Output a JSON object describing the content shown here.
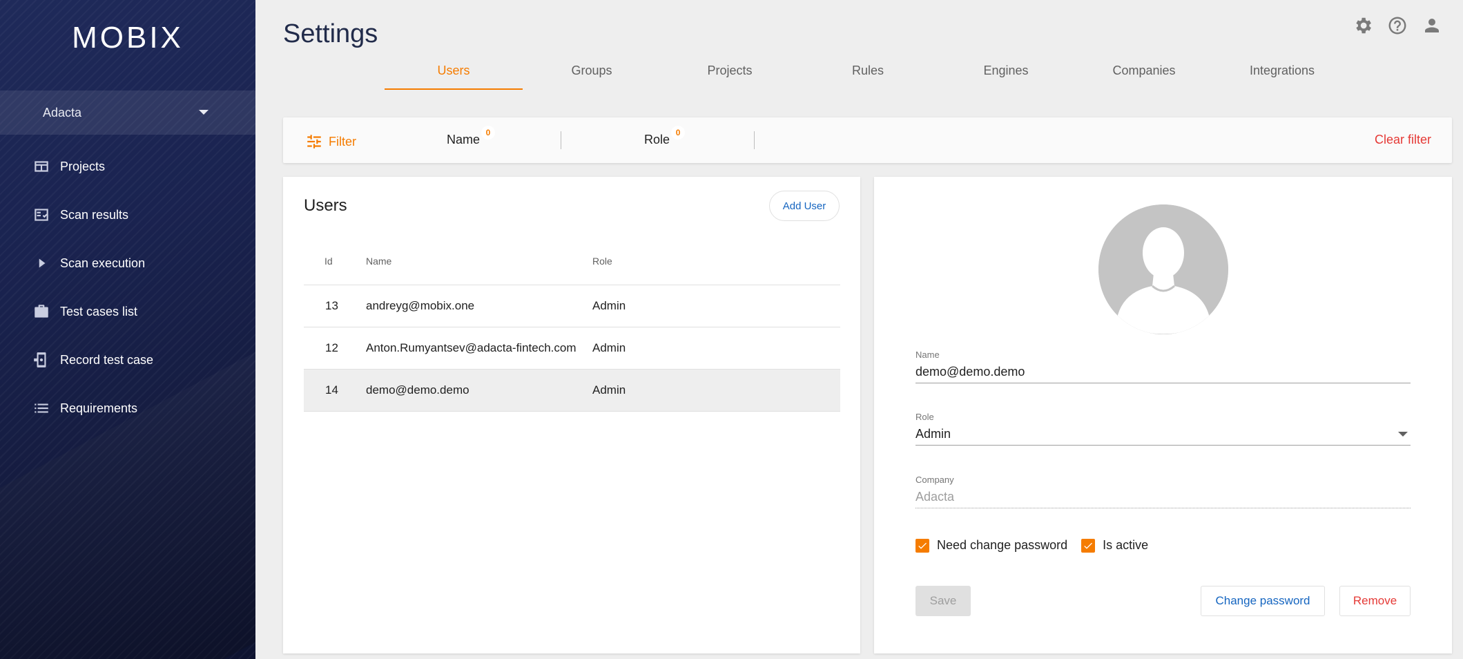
{
  "app": {
    "logo": "MOBIX"
  },
  "sidebar": {
    "company": "Adacta",
    "items": [
      {
        "label": "Projects",
        "icon": "projects-icon"
      },
      {
        "label": "Scan results",
        "icon": "scan-results-icon"
      },
      {
        "label": "Scan execution",
        "icon": "play-icon"
      },
      {
        "label": "Test cases list",
        "icon": "briefcase-icon"
      },
      {
        "label": "Record test case",
        "icon": "record-device-icon"
      },
      {
        "label": "Requirements",
        "icon": "list-icon"
      }
    ]
  },
  "header": {
    "title": "Settings",
    "icons": [
      "gear-icon",
      "help-icon",
      "account-icon"
    ]
  },
  "tabs": [
    {
      "label": "Users",
      "active": true
    },
    {
      "label": "Groups"
    },
    {
      "label": "Projects"
    },
    {
      "label": "Rules"
    },
    {
      "label": "Engines"
    },
    {
      "label": "Companies"
    },
    {
      "label": "Integrations"
    }
  ],
  "filter": {
    "label": "Filter",
    "columns": [
      {
        "label": "Name",
        "count": "0"
      },
      {
        "label": "Role",
        "count": "0"
      }
    ],
    "clear": "Clear filter"
  },
  "users": {
    "title": "Users",
    "add_button": "Add User",
    "headers": {
      "id": "Id",
      "name": "Name",
      "role": "Role"
    },
    "rows": [
      {
        "id": "13",
        "name": "andreyg@mobix.one",
        "role": "Admin"
      },
      {
        "id": "12",
        "name": "Anton.Rumyantsev@adacta-fintech.com",
        "role": "Admin"
      },
      {
        "id": "14",
        "name": "demo@demo.demo",
        "role": "Admin",
        "selected": true
      }
    ]
  },
  "detail": {
    "name_label": "Name",
    "name_value": "demo@demo.demo",
    "role_label": "Role",
    "role_value": "Admin",
    "company_label": "Company",
    "company_value": "Adacta",
    "need_change_password": "Need change password",
    "is_active": "Is active",
    "save": "Save",
    "change_password": "Change password",
    "remove": "Remove"
  },
  "colors": {
    "accent": "#f57c00",
    "link": "#1565c0",
    "danger": "#e53935",
    "sidebar": "#1a2350"
  }
}
